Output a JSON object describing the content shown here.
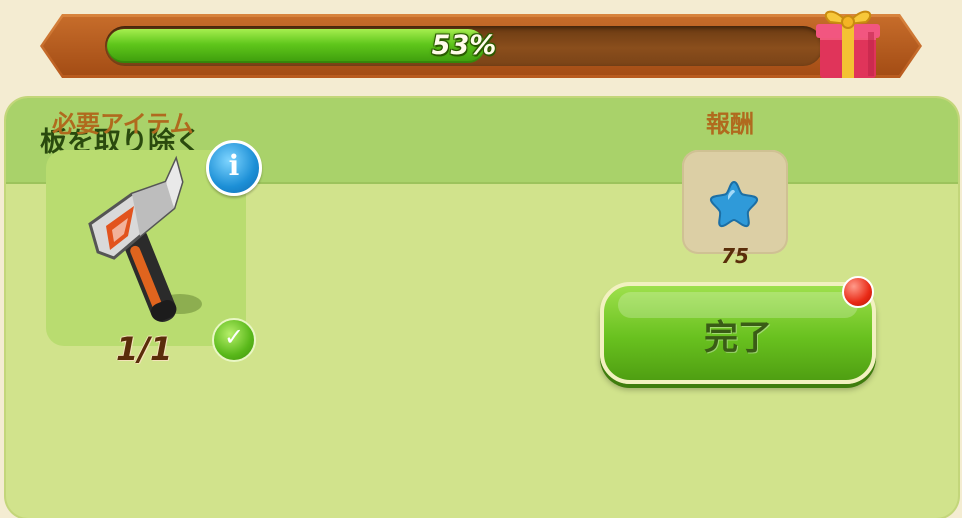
{
  "progress": {
    "percent_label": "53%",
    "value": 0.53,
    "fill_color": "#5fc61b",
    "reward_icon": "gift-box-icon"
  },
  "task": {
    "title": "板を取り除く",
    "required_label": "必要アイテム",
    "reward_label": "報酬",
    "required_item": {
      "icon": "hammer-icon",
      "count": "1/1",
      "info_icon": "info-icon",
      "status_icon": "check-icon",
      "check_glyph": "✓"
    },
    "reward": {
      "icon": "blue-star-gem-icon",
      "amount": "75"
    },
    "complete_button": {
      "label": "完了",
      "has_notification": true
    }
  },
  "colors": {
    "panel": "#d1e38c",
    "header": "#a9d26a",
    "label_orange": "#b06a1e",
    "button_green": "#69c11f"
  }
}
